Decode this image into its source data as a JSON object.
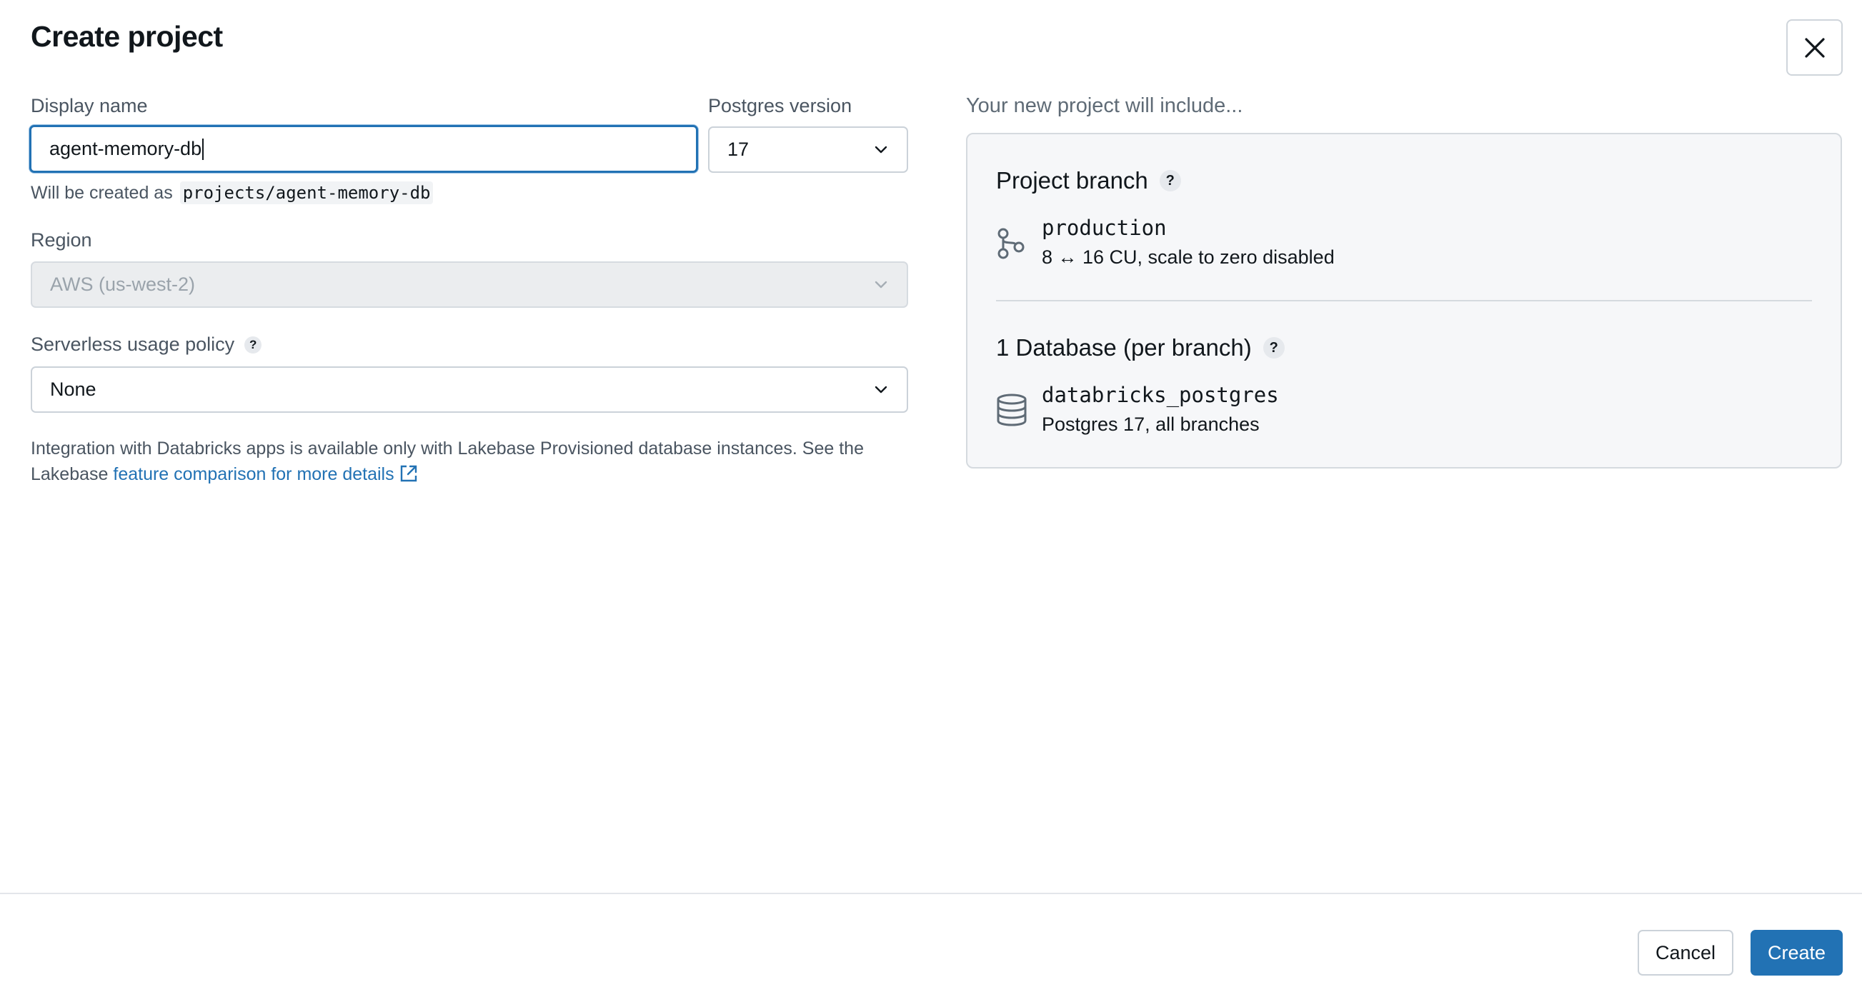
{
  "dialog": {
    "title": "Create project",
    "close_icon": "close-icon"
  },
  "form": {
    "display_name": {
      "label": "Display name",
      "value": "agent-memory-db"
    },
    "created_as": {
      "prefix": "Will be created as",
      "path": "projects/agent-memory-db"
    },
    "postgres_version": {
      "label": "Postgres version",
      "value": "17"
    },
    "region": {
      "label": "Region",
      "value": "AWS (us-west-2)",
      "disabled": true
    },
    "usage_policy": {
      "label": "Serverless usage policy",
      "value": "None"
    },
    "note": {
      "text": "Integration with Databricks apps is available only with Lakebase Provisioned database instances. See the Lakebase ",
      "link": "feature comparison for more details"
    }
  },
  "summary": {
    "label": "Your new project will include...",
    "branch": {
      "heading": "Project branch",
      "name": "production",
      "detail": "8 ↔ 16 CU, scale to zero disabled",
      "icon": "branch-icon"
    },
    "database": {
      "heading": "1 Database (per branch)",
      "name": "databricks_postgres",
      "detail": "Postgres 17, all branches",
      "icon": "database-icon"
    }
  },
  "footer": {
    "cancel_label": "Cancel",
    "create_label": "Create"
  },
  "colors": {
    "accent": "#2272b4",
    "text": "#11171c",
    "muted": "#4a5561",
    "card_bg": "#f6f7f9"
  }
}
